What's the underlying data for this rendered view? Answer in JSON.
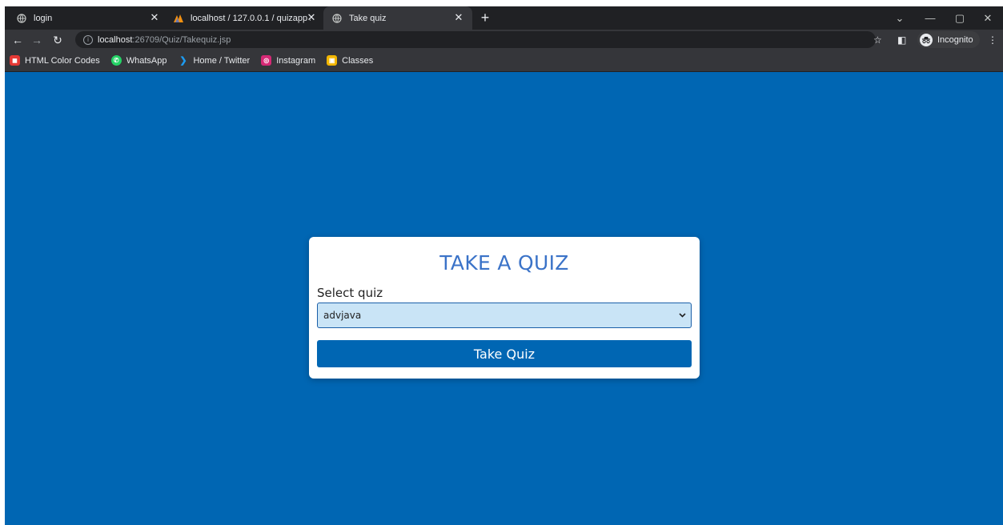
{
  "browser": {
    "tabs": [
      {
        "label": "login",
        "icon": "globe-icon",
        "active": false
      },
      {
        "label": "localhost / 127.0.0.1 / quizapp / ",
        "icon": "phpmyadmin-icon",
        "active": false
      },
      {
        "label": "Take quiz",
        "icon": "globe-icon",
        "active": true
      }
    ],
    "new_tab_label": "+",
    "window_controls": [
      "⌄",
      "—",
      "▢",
      "✕"
    ],
    "address": {
      "host": "localhost",
      "path": ":26709/Quiz/Takequiz.jsp"
    },
    "incognito_label": "Incognito",
    "bookmarks": [
      {
        "label": "HTML Color Codes",
        "icon": "htmlcolorcodes-icon",
        "color": "#e53935"
      },
      {
        "label": "WhatsApp",
        "icon": "whatsapp-icon",
        "color": "#25d366"
      },
      {
        "label": "Home / Twitter",
        "icon": "twitter-icon",
        "color": "#1d9bf0"
      },
      {
        "label": "Instagram",
        "icon": "instagram-icon",
        "color": "#d62976"
      },
      {
        "label": "Classes",
        "icon": "classroom-icon",
        "color": "#f2b600"
      }
    ]
  },
  "page": {
    "background": "#0066b3",
    "title": "TAKE A QUIZ",
    "select_label": "Select quiz",
    "select_value": "advjava",
    "submit_label": "Take Quiz"
  }
}
